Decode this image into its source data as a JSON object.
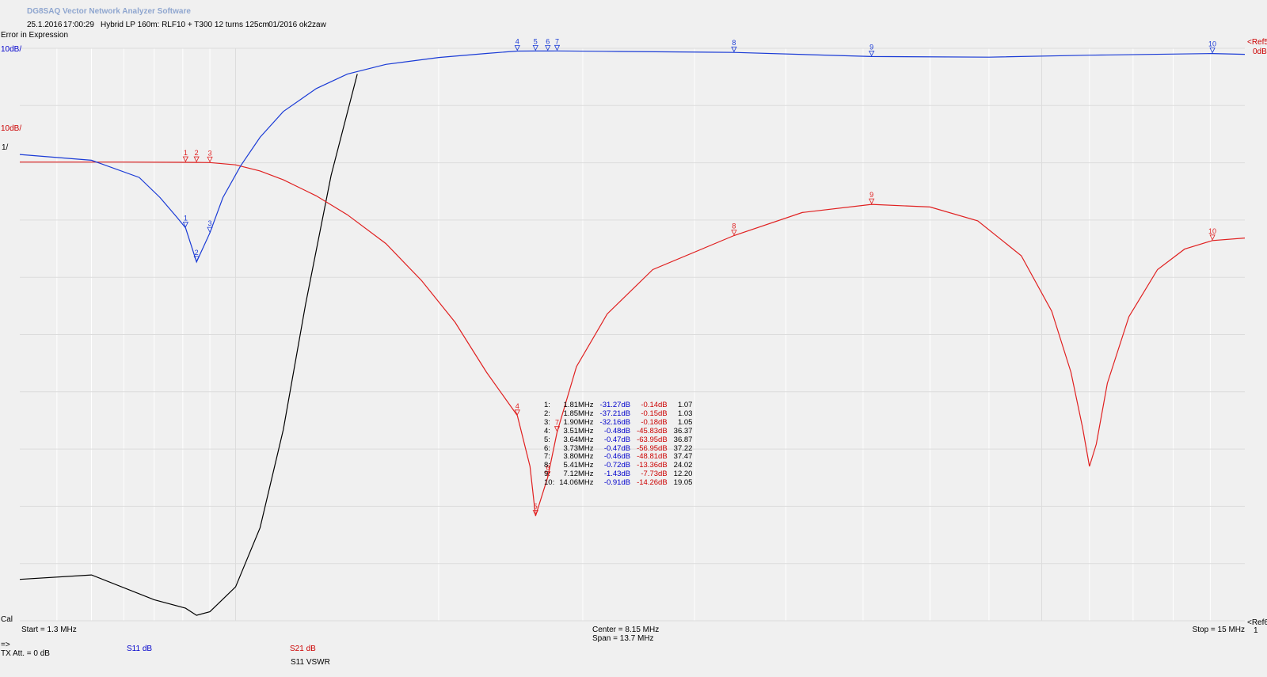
{
  "header": {
    "app_title": "DG8SAQ Vector Network Analyzer Software",
    "date": "25.1.2016",
    "time": "17:00:29",
    "title": "Hybrid LP 160m: RLF10 + T300 12 turns 125cm",
    "note": "01/2016 ok2zaw",
    "error": "Error in Expression"
  },
  "scales": {
    "s11": "10dB/",
    "s21": "10dB/",
    "vswr": "1/",
    "cal": "Cal",
    "ref5": "<Ref5",
    "ref5b": "0dB",
    "ref6": "<Ref6",
    "ref6b": "1"
  },
  "footer": {
    "start": "Start = 1.3 MHz",
    "center": "Center = 8.15 MHz",
    "span": "Span = 13.7 MHz",
    "stop": "Stop = 15 MHz",
    "arrow": "=>",
    "txatt": "TX Att. = 0 dB"
  },
  "legend": {
    "s11": "S11  dB",
    "s21": "S21  dB",
    "vswr": "S11  VSWR"
  },
  "colors": {
    "s11": "#1a3bd6",
    "s21": "#e02020",
    "vswr": "#000000",
    "grid": "#ffffff",
    "background": "#f0f0f0"
  },
  "markers": [
    {
      "idx": "1:",
      "freq": "1.81MHz",
      "s11": "-31.27dB",
      "s21": "-0.14dB",
      "vswr": "1.07"
    },
    {
      "idx": "2:",
      "freq": "1.85MHz",
      "s11": "-37.21dB",
      "s21": "-0.15dB",
      "vswr": "1.03"
    },
    {
      "idx": "3:",
      "freq": "1.90MHz",
      "s11": "-32.16dB",
      "s21": "-0.18dB",
      "vswr": "1.05"
    },
    {
      "idx": "4:",
      "freq": "3.51MHz",
      "s11": "-0.48dB",
      "s21": "-45.83dB",
      "vswr": "36.37"
    },
    {
      "idx": "5:",
      "freq": "3.64MHz",
      "s11": "-0.47dB",
      "s21": "-63.95dB",
      "vswr": "36.87"
    },
    {
      "idx": "6:",
      "freq": "3.73MHz",
      "s11": "-0.47dB",
      "s21": "-56.95dB",
      "vswr": "37.22"
    },
    {
      "idx": "7:",
      "freq": "3.80MHz",
      "s11": "-0.46dB",
      "s21": "-48.81dB",
      "vswr": "37.47"
    },
    {
      "idx": "8:",
      "freq": "5.41MHz",
      "s11": "-0.72dB",
      "s21": "-13.36dB",
      "vswr": "24.02"
    },
    {
      "idx": "9:",
      "freq": "7.12MHz",
      "s11": "-1.43dB",
      "s21": "-7.73dB",
      "vswr": "12.20"
    },
    {
      "idx": "10:",
      "freq": "14.06MHz",
      "s11": "-0.91dB",
      "s21": "-14.26dB",
      "vswr": "19.05"
    }
  ],
  "chart_data": {
    "type": "line",
    "x_unit": "MHz",
    "xlim": [
      1.3,
      15
    ],
    "x_scale": "log",
    "s11_db_ref": 0,
    "s11_db_per_div": 10,
    "s21_db_per_div": 10,
    "grid": true,
    "series": [
      {
        "name": "S11  dB",
        "color": "#1a3bd6",
        "x": [
          1.3,
          1.5,
          1.65,
          1.72,
          1.78,
          1.81,
          1.85,
          1.9,
          1.95,
          2.02,
          2.1,
          2.2,
          2.35,
          2.5,
          2.7,
          3.0,
          3.3,
          3.51,
          3.64,
          3.73,
          3.8,
          4.3,
          5.41,
          7.12,
          9.0,
          11.0,
          14.06,
          15.0
        ],
        "values": [
          -18.5,
          -19.5,
          -22.5,
          -26,
          -29.5,
          -31.27,
          -37.21,
          -32.16,
          -26,
          -20.5,
          -15.5,
          -11,
          -7,
          -4.5,
          -2.8,
          -1.6,
          -0.9,
          -0.48,
          -0.47,
          -0.47,
          -0.46,
          -0.55,
          -0.72,
          -1.43,
          -1.55,
          -1.2,
          -0.91,
          -1.05
        ]
      },
      {
        "name": "S21  dB",
        "color": "#e02020",
        "x": [
          1.3,
          1.6,
          1.81,
          1.85,
          1.9,
          2.0,
          2.1,
          2.2,
          2.35,
          2.5,
          2.7,
          2.9,
          3.1,
          3.3,
          3.51,
          3.6,
          3.64,
          3.73,
          3.8,
          3.95,
          4.2,
          4.6,
          5.41,
          6.2,
          7.12,
          8.0,
          8.8,
          9.6,
          10.2,
          10.6,
          10.85,
          11.0,
          11.15,
          11.4,
          11.9,
          12.6,
          13.3,
          14.06,
          15.0
        ],
        "values": [
          -0.1,
          -0.1,
          -0.14,
          -0.15,
          -0.18,
          -0.6,
          -1.7,
          -3.3,
          -6.2,
          -9.6,
          -14.8,
          -21.5,
          -29,
          -38,
          -45.83,
          -55,
          -63.95,
          -56.95,
          -48.81,
          -37,
          -27.5,
          -19.5,
          -13.36,
          -9.2,
          -7.73,
          -8.2,
          -10.7,
          -17,
          -27,
          -38,
          -48,
          -55,
          -51,
          -40,
          -28,
          -19.5,
          -15.8,
          -14.26,
          -13.8
        ]
      },
      {
        "name": "S11  VSWR",
        "color": "#000000",
        "x": [
          1.3,
          1.5,
          1.7,
          1.81,
          1.85,
          1.9,
          2.0,
          2.1,
          2.2,
          2.3,
          2.42,
          2.55
        ],
        "values": [
          1.25,
          1.28,
          1.12,
          1.07,
          1.03,
          1.05,
          1.2,
          1.65,
          2.8,
          5.5,
          11,
          19
        ]
      }
    ]
  }
}
